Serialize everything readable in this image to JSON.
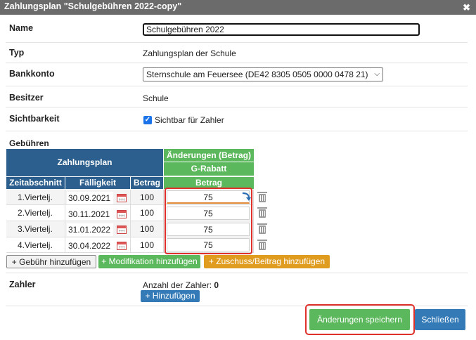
{
  "dialog": {
    "title": "Zahlungsplan \"Schulgebühren 2022-copy\"",
    "close_glyph": "✖"
  },
  "form": {
    "name_label": "Name",
    "name_value": "Schulgebühren 2022",
    "typ_label": "Typ",
    "typ_value": "Zahlungsplan der Schule",
    "bank_label": "Bankkonto",
    "bank_value": "Sternschule am Feuersee (DE42 8305 0505 0000 0478 21)",
    "owner_label": "Besitzer",
    "owner_value": "Schule",
    "visibility_label": "Sichtbarkeit",
    "visibility_checkbox_label": "Sichtbar für Zahler",
    "visibility_checked": true,
    "fees_label": "Gebühren"
  },
  "fees_table": {
    "group_plan": "Zahlungsplan",
    "group_changes": "Änderungen (Betrag)",
    "sub_group": "G-Rabatt",
    "col_period": "Zeitabschnitt",
    "col_due": "Fälligkeit",
    "col_amount": "Betrag",
    "col_change_amount": "Betrag",
    "rows": [
      {
        "period": "1.Viertelj.",
        "due": "30.09.2021",
        "amount": "100",
        "change": "75"
      },
      {
        "period": "2.Viertelj.",
        "due": "30.11.2021",
        "amount": "100",
        "change": "75"
      },
      {
        "period": "3.Viertelj.",
        "due": "31.01.2022",
        "amount": "100",
        "change": "75"
      },
      {
        "period": "4.Viertelj.",
        "due": "30.04.2022",
        "amount": "100",
        "change": "75"
      }
    ]
  },
  "actions": {
    "add_fee": "+ Gebühr hinzufügen",
    "add_modification": "+ Modifikation hinzufügen",
    "add_subsidy": "+ Zuschuss/Beitrag hinzufügen"
  },
  "payers": {
    "label": "Zahler",
    "count_label": "Anzahl der Zahler:",
    "count_value": "0",
    "add_button": "+ Hinzufügen"
  },
  "footer": {
    "save_button": "Änderungen speichern",
    "close_button": "Schließen"
  },
  "colors": {
    "title_bar": "#6b6b6b",
    "header_blue": "#2c5f8d",
    "header_green": "#5cb85c",
    "button_orange": "#e09c1e",
    "button_blue": "#337ab7",
    "highlight_red": "#e0302b"
  }
}
